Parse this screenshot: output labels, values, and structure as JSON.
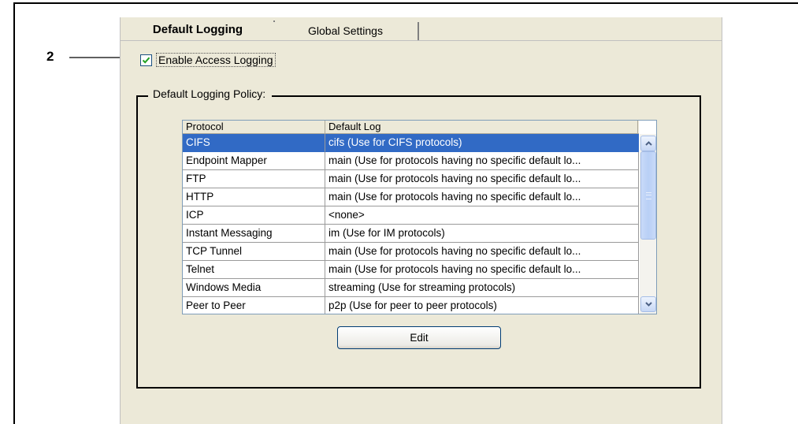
{
  "callout": {
    "number": "2"
  },
  "tabs": [
    {
      "label": "Default Logging",
      "active": true
    },
    {
      "label": "Global Settings",
      "active": false
    }
  ],
  "enable_access_logging": {
    "label": "Enable Access Logging",
    "checked": true
  },
  "policy_group": {
    "legend": "Default Logging Policy:"
  },
  "table": {
    "columns": [
      "Protocol",
      "Default Log"
    ],
    "rows": [
      {
        "protocol": "CIFS",
        "default_log": "cifs (Use for CIFS protocols)",
        "selected": true
      },
      {
        "protocol": "Endpoint Mapper",
        "default_log": "main (Use for protocols having no specific default lo..."
      },
      {
        "protocol": "FTP",
        "default_log": "main (Use for protocols having no specific default lo..."
      },
      {
        "protocol": "HTTP",
        "default_log": "main (Use for protocols having no specific default lo..."
      },
      {
        "protocol": "ICP",
        "default_log": "<none>"
      },
      {
        "protocol": "Instant Messaging",
        "default_log": "im (Use for IM protocols)"
      },
      {
        "protocol": "TCP Tunnel",
        "default_log": "main (Use for protocols having no specific default lo..."
      },
      {
        "protocol": "Telnet",
        "default_log": "main (Use for protocols having no specific default lo..."
      },
      {
        "protocol": "Windows Media",
        "default_log": "streaming (Use for streaming protocols)"
      },
      {
        "protocol": "Peer to Peer",
        "default_log": "p2p (Use for peer to peer protocols)"
      }
    ]
  },
  "edit_button": {
    "label": "Edit"
  },
  "colors": {
    "selection": "#316ac5",
    "dialog_bg": "#ece9d8",
    "checkbox_check": "#21a121"
  },
  "icons": {
    "checkbox": "checkmark-icon",
    "scroll_up": "chevron-up-icon",
    "scroll_down": "chevron-down-icon"
  }
}
